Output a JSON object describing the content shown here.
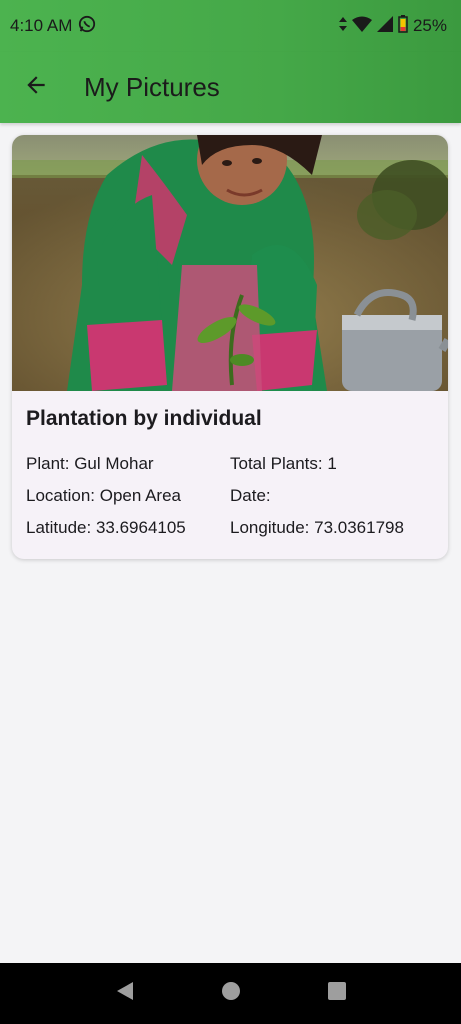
{
  "status_bar": {
    "time": "4:10 AM",
    "battery": "25%"
  },
  "app_bar": {
    "title": "My Pictures"
  },
  "card": {
    "title": "Plantation by individual",
    "plant": "Plant: Gul Mohar",
    "total_plants": "Total Plants: 1",
    "location": "Location: Open Area",
    "date": "Date:",
    "latitude": "Latitude: 33.6964105",
    "longitude": "Longitude: 73.0361798"
  },
  "colors": {
    "app_bar_green": "#45a848",
    "background": "#f4f4f6",
    "card_background": "#f6f2f8"
  },
  "icons": {
    "back": "arrow-left-icon",
    "whatsapp": "whatsapp-icon",
    "wifi": "wifi-icon",
    "signal": "signal-icon",
    "battery": "battery-icon",
    "nav_back": "triangle-back-icon",
    "nav_home": "circle-home-icon",
    "nav_recents": "square-recents-icon"
  }
}
